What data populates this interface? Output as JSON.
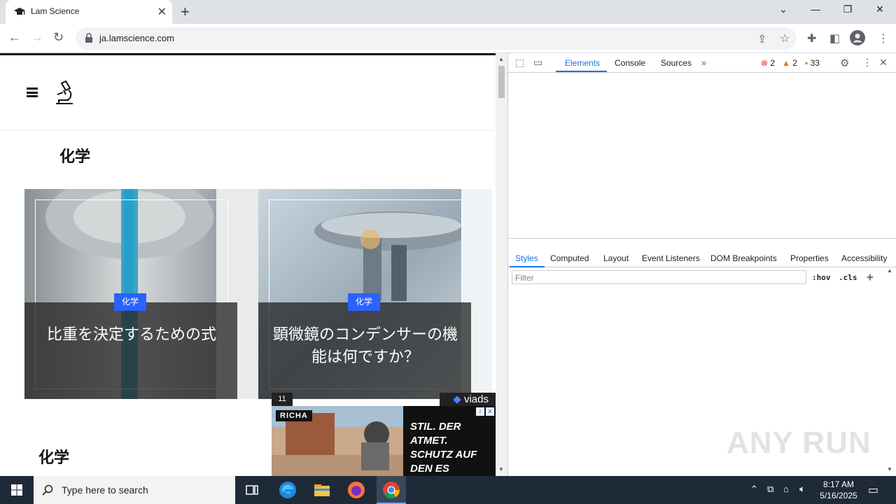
{
  "browser": {
    "tab_title": "Lam Science",
    "url": "ja.lamscience.com"
  },
  "page": {
    "section_title": "化学",
    "cards": [
      {
        "tag": "化学",
        "title": "比重を決定するための式"
      },
      {
        "tag": "化学",
        "title": "顕微鏡のコンデンサーの機能は何ですか？"
      }
    ],
    "section_title_2": "化学"
  },
  "ad": {
    "counter": "11",
    "brand": "viads",
    "logo_text": "RICHA",
    "headline": "STIL. DER ATMET. SCHUTZ AUF DEN ES ANKOMMT."
  },
  "devtools": {
    "tabs": [
      "Elements",
      "Console",
      "Sources"
    ],
    "errors": "2",
    "warnings": "2",
    "issues": "33",
    "styles_tabs": [
      "Styles",
      "Computed",
      "Layout",
      "Event Listeners",
      "DOM Breakpoints",
      "Properties",
      "Accessibility"
    ],
    "filter_placeholder": "Filter",
    "hov": ":hov",
    "cls": ".cls"
  },
  "taskbar": {
    "search_placeholder": "Type here to search",
    "time": "8:17 AM",
    "date": "5/16/2025"
  },
  "watermark": "ANY RUN",
  "colors": {
    "accent": "#1a73e8",
    "tag_blue": "#2962ff",
    "taskbar": "#1f2a38"
  }
}
